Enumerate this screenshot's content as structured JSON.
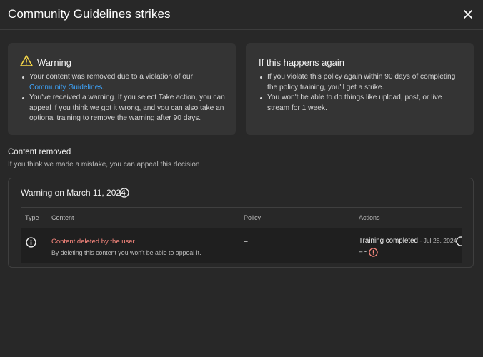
{
  "dialog": {
    "title": "Community Guidelines strikes"
  },
  "warning_card": {
    "title": "Warning",
    "bullet1_text": "Your content was removed due to a violation of our ",
    "bullet1_link": "Community Guidelines",
    "bullet1_end": ".",
    "bullet2": "You've received a warning. If you select Take action, you can appeal if you think we got it wrong, and you can also take an optional training to remove the warning after 90 days."
  },
  "again_card": {
    "title": "If this happens again",
    "bullet1": "If you violate this policy again within 90 days of completing the policy training, you'll get a strike.",
    "bullet2": "You won't be able to do things like upload, post, or live stream for 1 week."
  },
  "content_removed": {
    "title": "Content removed",
    "subtitle": "If you think we made a mistake, you can appeal this decision"
  },
  "panel": {
    "title": "Warning on March 11, 2024",
    "columns": [
      "Type",
      "Content",
      "Policy",
      "Actions"
    ],
    "row": {
      "content_title": "Content deleted by the user",
      "content_note": "By deleting this content you won't be able to appeal it.",
      "policy": "–",
      "action_status": "Training completed",
      "action_date": " - Jul 28, 2024",
      "action_sub": "– -"
    }
  },
  "colors": {
    "background": "#282828",
    "card": "#343434",
    "link": "#3ea6ff",
    "warning_icon": "#f9d949",
    "removed_text": "#ff8a80"
  },
  "icons": [
    "close-icon",
    "warning-icon",
    "info-icon",
    "alert-circle-icon"
  ]
}
